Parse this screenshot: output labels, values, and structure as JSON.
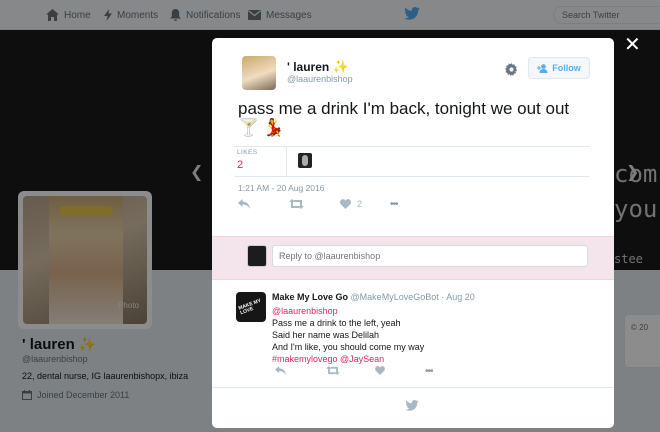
{
  "nav": {
    "home": "Home",
    "moments": "Moments",
    "notifications": "Notifications",
    "messages": "Messages",
    "search_placeholder": "Search Twitter"
  },
  "banner": {
    "text_line1": "com",
    "text_line2": "you",
    "text_line3": "stee"
  },
  "profile": {
    "name": "' lauren",
    "sparkle": "✨",
    "handle": "@laaurenbishop",
    "bio": "22, dental nurse, IG laaurenbishopx, ibiza",
    "joined": "Joined December 2011",
    "photo_watermark": "Photo"
  },
  "right_card": {
    "text": "© 20"
  },
  "modal": {
    "close": "✕",
    "author_name": "' lauren",
    "author_sparkle": "✨",
    "author_handle": "@laaurenbishop",
    "follow_label": "Follow",
    "tweet_text": "pass me a drink I'm back, tonight we out out",
    "emoji_1": "🍸",
    "emoji_2": "💃",
    "likes_label": "LIKES",
    "likes_count": "2",
    "date": "1:21 AM - 20 Aug 2016",
    "like_action_count": "2",
    "more_label": "•••",
    "reply_placeholder": "Reply to @laaurenbishop",
    "reply": {
      "name": "Make My Love Go",
      "handle": "@MakeMyLoveGoBot",
      "separator": "·",
      "date": "Aug 20",
      "mention": "@laaurenbishop",
      "line1": "Pass me a drink to the left, yeah",
      "line2": "Said her name was Delilah",
      "line3": "And I'm like, you should come my way",
      "hashtags": "#makemylovego @JaySean",
      "avatar_text": "MAKE MY LOVE",
      "more_label": "•••"
    }
  },
  "colors": {
    "accent": "#55acee",
    "like": "#e0245e",
    "reply_bg": "#f4e5ec"
  }
}
